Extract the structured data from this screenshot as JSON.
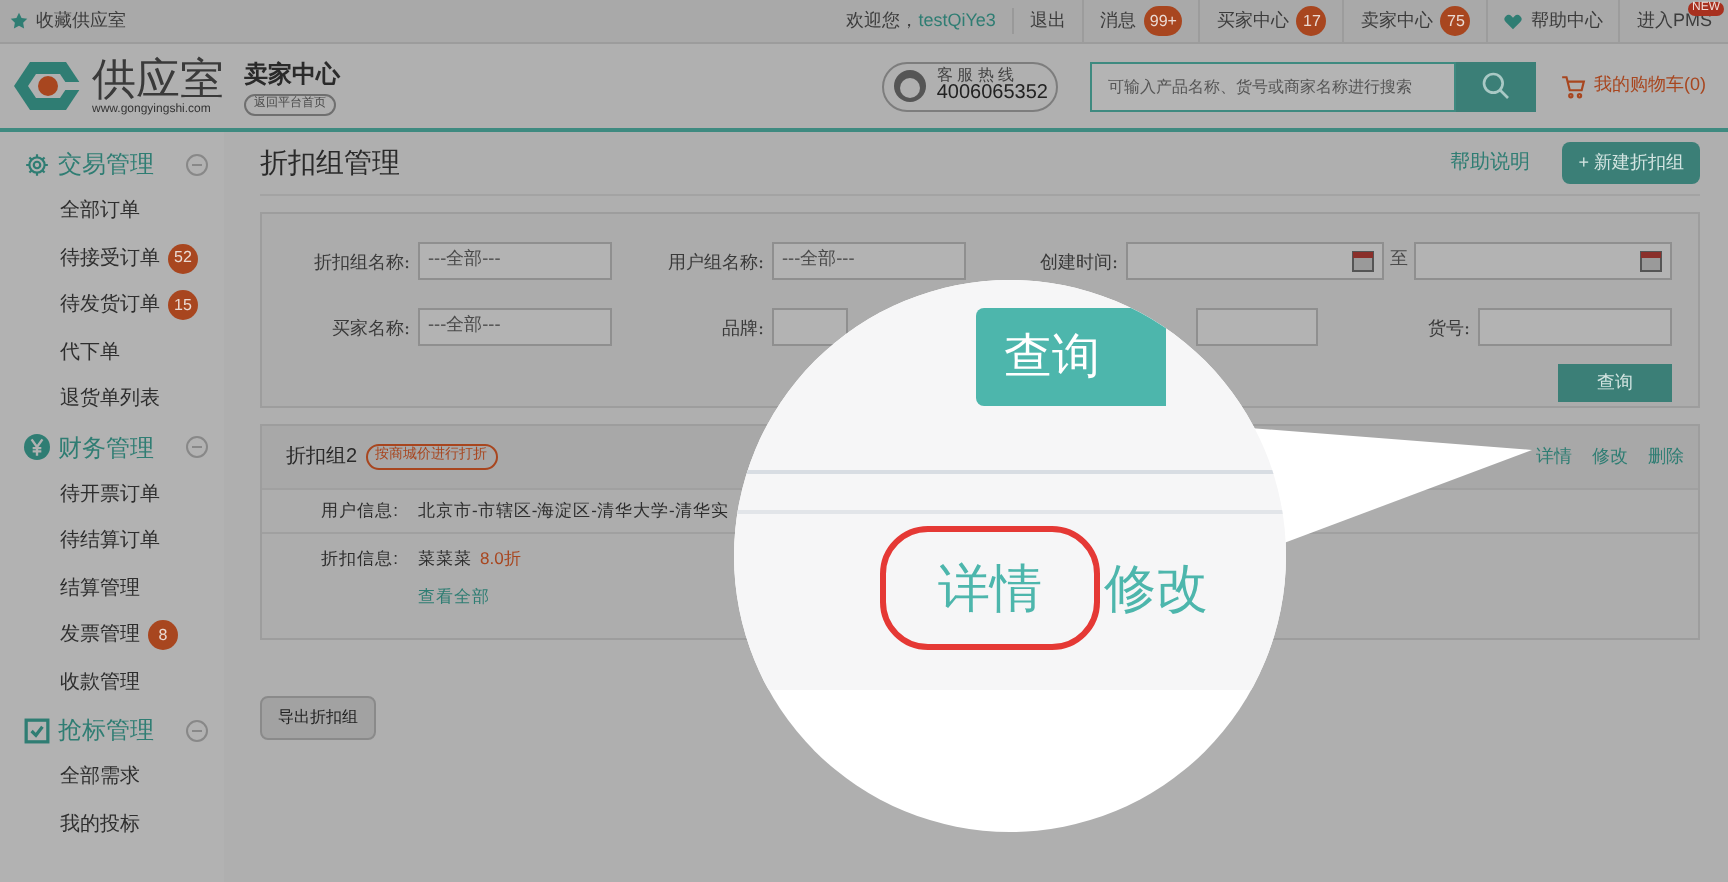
{
  "top_bar": {
    "bookmark": "收藏供应室",
    "welcome": "欢迎您，",
    "username": "testQiYe3",
    "logout": "退出",
    "links": [
      {
        "label": "消息",
        "badge": "99+"
      },
      {
        "label": "买家中心",
        "badge": "17"
      },
      {
        "label": "卖家中心",
        "badge": "75"
      },
      {
        "label": "帮助中心"
      },
      {
        "label": "进入PMS",
        "new_tag": "NEW"
      }
    ]
  },
  "header": {
    "logo_name": "供应室",
    "logo_url": "www.gongyingshi.com",
    "center_title": "卖家中心",
    "back_link": "返回平台首页",
    "hotline_label": "客 服 热 线",
    "hotline_number": "4006065352",
    "search": {
      "placeholder": "可输入产品名称、货号或商家名称进行搜索"
    },
    "cart": "我的购物车(0)"
  },
  "sidebar": [
    {
      "title": "交易管理",
      "expanded": true,
      "items": [
        {
          "label": "全部订单"
        },
        {
          "label": "待接受订单",
          "badge": "52"
        },
        {
          "label": "待发货订单",
          "badge": "15"
        },
        {
          "label": "代下单"
        },
        {
          "label": "退货单列表"
        }
      ]
    },
    {
      "title": "财务管理",
      "expanded": true,
      "items": [
        {
          "label": "待开票订单"
        },
        {
          "label": "待结算订单"
        },
        {
          "label": "结算管理"
        },
        {
          "label": "发票管理",
          "badge": "8"
        },
        {
          "label": "收款管理"
        }
      ]
    },
    {
      "title": "抢标管理",
      "expanded": true,
      "items": [
        {
          "label": "全部需求"
        },
        {
          "label": "我的投标"
        }
      ]
    }
  ],
  "page": {
    "title": "折扣组管理",
    "help_link": "帮助说明",
    "new_button": "+ 新建折扣组"
  },
  "filters": {
    "row_1": [
      {
        "kind": "text",
        "label": "折扣组名称:",
        "placeholder": "---全部---"
      },
      {
        "kind": "text",
        "label": "用户组名称:",
        "placeholder": "---全部---"
      },
      {
        "kind": "date_range",
        "label": "创建时间:",
        "separator": "至"
      }
    ],
    "row_2": [
      {
        "kind": "text",
        "label": "买家名称:",
        "placeholder": "---全部---"
      },
      {
        "kind": "short",
        "label": "品牌:"
      },
      {
        "kind": "partial"
      },
      {
        "kind": "text",
        "label": "货号:"
      }
    ],
    "query_button": "查询"
  },
  "group_card": {
    "name": "折扣组2",
    "tag": "按商城价进行打折",
    "actions": [
      "详情",
      "修改",
      "删除"
    ],
    "user_label": "用户信息:",
    "user_value": "北京市-市辖区-海淀区-清华大学-清华实",
    "discount_label": "折扣信息:",
    "discount_item": "菜菜菜",
    "discount_value": "8.0折",
    "view_all": "查看全部"
  },
  "export_button": "导出折扣组",
  "magnifier": {
    "query_button": "查询",
    "actions": [
      {
        "label": "详情",
        "selected": true
      },
      {
        "label": "修改",
        "selected": false
      }
    ]
  }
}
